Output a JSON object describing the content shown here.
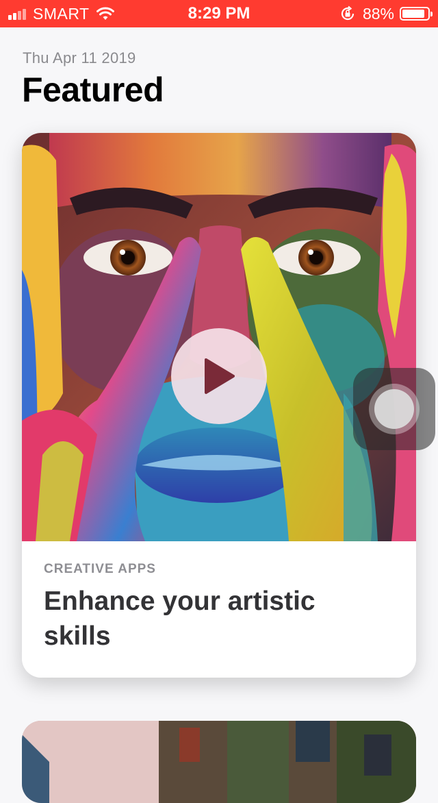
{
  "status_bar": {
    "carrier": "SMART",
    "time": "8:29 PM",
    "battery_percent": "88%",
    "battery_level": 0.88,
    "signal_bars_filled": 2,
    "signal_bars_total": 4,
    "background_color": "#ff3b30",
    "icons": [
      "signal-bars-icon",
      "wifi-icon",
      "orientation-lock-icon",
      "battery-icon"
    ]
  },
  "header": {
    "date": "Thu Apr 11 2019",
    "title": "Featured"
  },
  "featured_card": {
    "category": "CREATIVE APPS",
    "title": "Enhance your artistic skills",
    "media": {
      "has_video": true,
      "play_icon": "play-icon"
    }
  },
  "assistive_touch": {
    "icon": "assistive-touch-icon"
  }
}
